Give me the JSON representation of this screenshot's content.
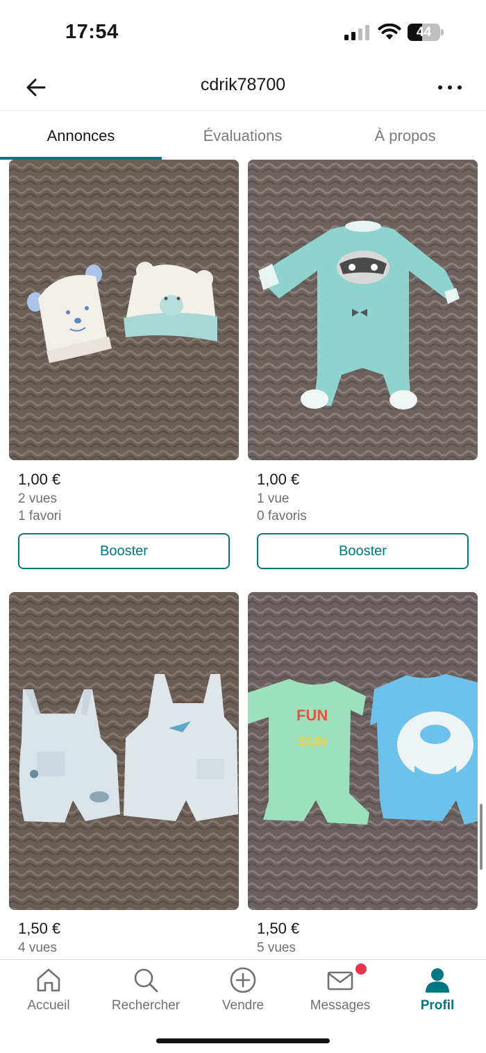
{
  "status_bar": {
    "time": "17:54",
    "battery_level": "44",
    "battery_fraction": 0.44
  },
  "header": {
    "title": "cdrik78700",
    "back_icon": "arrow-left-icon",
    "more_icon": "ellipsis-horizontal-icon"
  },
  "tabs": [
    {
      "label": "Annonces",
      "active": true
    },
    {
      "label": "Évaluations",
      "active": false
    },
    {
      "label": "À propos",
      "active": false
    }
  ],
  "listings": [
    {
      "image": "two-baby-bear-hats",
      "price": "1,00 €",
      "views": "2 vues",
      "favorites": "1 favori",
      "button": "Booster"
    },
    {
      "image": "mint-panda-footed-sleepsuit",
      "price": "1,00 €",
      "views": "1 vue",
      "favorites": "0 favoris",
      "button": "Booster"
    },
    {
      "image": "two-light-blue-overall-shorts",
      "price": "1,50 €",
      "views": "4 vues"
    },
    {
      "image": "two-short-rompers",
      "price": "1,50 €",
      "views": "5 vues"
    }
  ],
  "bottom_nav": [
    {
      "label": "Accueil",
      "icon": "home-icon",
      "active": false
    },
    {
      "label": "Rechercher",
      "icon": "search-icon",
      "active": false
    },
    {
      "label": "Vendre",
      "icon": "plus-circle-icon",
      "active": false
    },
    {
      "label": "Messages",
      "icon": "mail-icon",
      "active": false,
      "has_badge": true
    },
    {
      "label": "Profil",
      "icon": "person-icon",
      "active": true
    }
  ],
  "colors": {
    "accent": "#007782",
    "badge": "#e5334a",
    "carpet": "#6a5f59"
  }
}
